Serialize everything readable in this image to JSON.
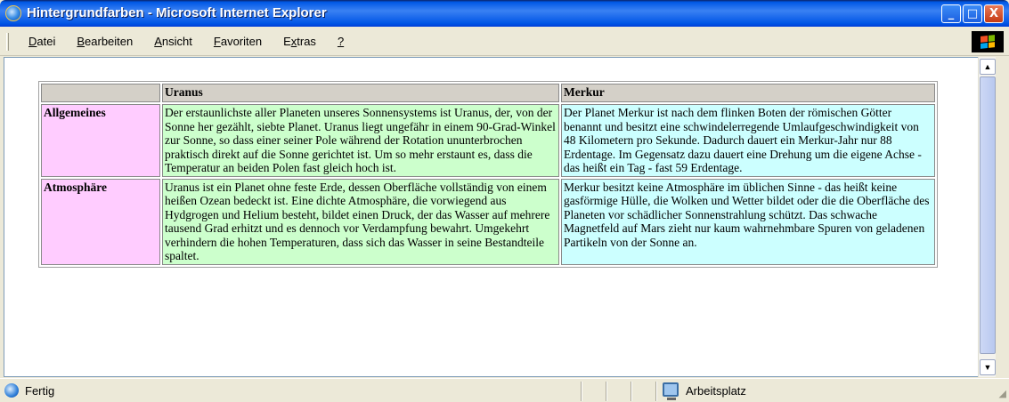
{
  "window": {
    "title": "Hintergrundfarben - Microsoft Internet Explorer",
    "controls": {
      "minimize": "_",
      "maximize": "□",
      "close": "X"
    }
  },
  "menu": {
    "items": [
      {
        "mnemonic": "D",
        "rest": "atei"
      },
      {
        "mnemonic": "B",
        "rest": "earbeiten"
      },
      {
        "mnemonic": "A",
        "rest": "nsicht"
      },
      {
        "mnemonic": "F",
        "rest": "avoriten"
      },
      {
        "pre": "E",
        "mnemonic": "x",
        "rest": "tras"
      },
      {
        "mnemonic": "?",
        "rest": ""
      }
    ]
  },
  "table": {
    "headers": [
      "",
      "Uranus",
      "Merkur"
    ],
    "rows": [
      {
        "label": "Allgemeines",
        "uranus": "Der erstaunlichste aller Planeten unseres Sonnensystems ist Uranus, der, von der Sonne her gezählt, siebte Planet. Uranus liegt ungefähr in einem 90-Grad-Winkel zur Sonne, so dass einer seiner Pole während der Rotation ununterbrochen praktisch direkt auf die Sonne gerichtet ist. Um so mehr erstaunt es, dass die Temperatur an beiden Polen fast gleich hoch ist.",
        "merkur": "Der Planet Merkur ist nach dem flinken Boten der römischen Götter benannt und besitzt eine schwindelerregende Umlaufgeschwindigkeit von 48 Kilometern pro Sekunde. Dadurch dauert ein Merkur-Jahr nur 88 Erdentage. Im Gegensatz dazu dauert eine Drehung um die eigene Achse - das heißt ein Tag - fast 59 Erdentage."
      },
      {
        "label": "Atmosphäre",
        "uranus": "Uranus ist ein Planet ohne feste Erde, dessen Oberfläche vollständig von einem heißen Ozean bedeckt ist. Eine dichte Atmosphäre, die vorwiegend aus Hydgrogen und Helium besteht, bildet einen Druck, der das Wasser auf mehrere tausend Grad erhitzt und es dennoch vor Verdampfung bewahrt. Umgekehrt verhindern die hohen Temperaturen, dass sich das Wasser in seine Bestandteile spaltet.",
        "merkur": "Merkur besitzt keine Atmosphäre im üblichen Sinne - das heißt keine gasförmige Hülle, die Wolken und Wetter bildet oder die die Oberfläche des Planeten vor schädlicher Sonnenstrahlung schützt. Das schwache Magnetfeld auf Mars zieht nur kaum wahrnehmbare Spuren von geladenen Partikeln von der Sonne an."
      }
    ]
  },
  "colors": {
    "header_cells": "#d4d0c8",
    "row_label_cells": "#ffccff",
    "uranus_cells": "#ccffcc",
    "merkur_cells": "#ccffff"
  },
  "status": {
    "text": "Fertig",
    "zone": "Arbeitsplatz"
  }
}
